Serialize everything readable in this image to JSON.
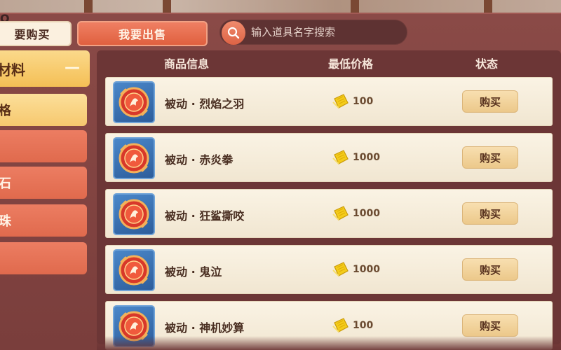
{
  "tabs": {
    "buy_label": "要购买",
    "sell_label": "我要出售"
  },
  "search": {
    "placeholder": "输入道具名字搜索"
  },
  "sidebar": {
    "header_label": "材料",
    "collapse_symbol": "—",
    "items": [
      {
        "label": "格",
        "active": true
      },
      {
        "label": "",
        "active": false
      },
      {
        "label": "石",
        "active": false
      },
      {
        "label": "珠",
        "active": false
      },
      {
        "label": "",
        "active": false
      }
    ]
  },
  "table": {
    "columns": [
      "商品信息",
      "最低价格",
      "状态"
    ],
    "rows": [
      {
        "name": "被动 · 烈焰之羽",
        "price": "100",
        "action": "购买",
        "icon": "fire-feather-icon"
      },
      {
        "name": "被动 · 赤炎拳",
        "price": "1000",
        "action": "购买",
        "icon": "fire-fist-icon"
      },
      {
        "name": "被动 · 狂鲨撕咬",
        "price": "1000",
        "action": "购买",
        "icon": "shark-bite-icon"
      },
      {
        "name": "被动 · 鬼泣",
        "price": "1000",
        "action": "购买",
        "icon": "ghost-cry-icon"
      },
      {
        "name": "被动 · 神机妙算",
        "price": "100",
        "action": "购买",
        "icon": "divine-scheme-icon"
      }
    ]
  },
  "colors": {
    "panel": "#7a3e3c",
    "accent_orange": "#e0603f",
    "accent_gold": "#f4bf55",
    "row_bg": "#faf3e4",
    "icon_bg": "#2d5d9b",
    "coin": "#f2c40f"
  }
}
